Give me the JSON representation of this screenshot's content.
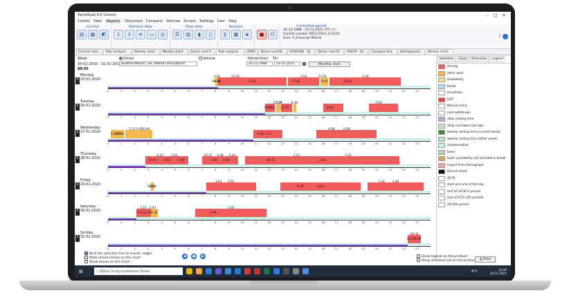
{
  "window": {
    "title": "TachoScan 6.6 Control",
    "menu": [
      "Control",
      "Data",
      "Reports",
      "Document",
      "Company",
      "Vehicles",
      "Drivers",
      "Settings",
      "User",
      "Help"
    ],
    "active_menu": "Reports"
  },
  "ribbon": {
    "groups": [
      {
        "label": "Control",
        "buttons": 3
      },
      {
        "label": "Retrieve data",
        "buttons": 5
      },
      {
        "label": "View data",
        "buttons": 4
      },
      {
        "label": "Analysis",
        "buttons": 3
      },
      {
        "label": "",
        "buttons": 2
      }
    ],
    "controlled_period": {
      "title": "Controlled period",
      "range": "26-12-1988 - 23-11-2021 UTC+1",
      "control_number": "Control number 0012-2021-123123",
      "user": "User: A_Franczyk Michał"
    }
  },
  "tabs": [
    "Current cont...",
    "Risk analysis ...",
    "Weekly chart...",
    "Weekly chart...",
    "Driver card P...",
    "Risk analysis ...",
    "DSRC",
    "Driver card M...",
    "GTKR188 - Di...",
    "Driver card M...",
    "P407R - Dr...",
    "Compare driv...",
    "Infringement...",
    "Weekly chart..."
  ],
  "header": {
    "week_label": "Week",
    "week_value": "25-01-2010 - 31-01-2010",
    "total": "88:05",
    "driver_label": "Driver",
    "vehicle_label": "Vehicle",
    "driver_value": "Budfeld Marion, GR 18WXBT3SFSQ6ER0",
    "period_from_label": "Period from",
    "till_label": "Till",
    "from_value": "26-12-1988",
    "till_value": "23-11-2021",
    "monthly_button": "Monthly chart"
  },
  "ticks": [
    "0",
    "1",
    "2",
    "3",
    "4",
    "5",
    "6",
    "7",
    "8",
    "9",
    "10",
    "11",
    "12",
    "13",
    "14",
    "15",
    "16",
    "17",
    "18",
    "19",
    "20",
    "21",
    "22",
    "23"
  ],
  "days": [
    {
      "name": "Monday",
      "date": "25-01-2010",
      "marks": [
        "06:28",
        "15:20",
        "17:30",
        "23:59",
        "12:44",
        "3:24",
        "0:54",
        "1:04",
        "0:45",
        "1:04",
        "0:44"
      ],
      "red": [
        [
          8.2,
          13.3
        ],
        [
          13.4,
          15.7
        ],
        [
          16.5,
          21.8
        ]
      ],
      "orange": [
        [
          8.0,
          8.2
        ],
        [
          15.8,
          16.4
        ]
      ]
    },
    {
      "name": "Tuesday",
      "date": "26-01-2010",
      "marks": [
        "06:28",
        "12:43",
        "22:47",
        "8:38",
        "2:04",
        "0:09",
        "2:11",
        "2:19"
      ],
      "red": [
        [
          11.7,
          12.4
        ],
        [
          12.9,
          13.7
        ],
        [
          16.0,
          17.5
        ],
        [
          19.4,
          21.6
        ]
      ],
      "orange": [
        [
          12.5,
          12.8
        ],
        [
          13.8,
          14.0
        ]
      ]
    },
    {
      "name": "Wednesday",
      "date": "27-01-2010",
      "marks": [
        "2:23",
        "2:23",
        "4:45",
        "0:58",
        "1:22",
        "1:45",
        "1:13",
        "0:58",
        "0:48",
        "10:49"
      ],
      "red": [
        [
          10.8,
          13.0
        ],
        [
          15.5,
          20.0
        ]
      ],
      "orange": [
        [
          0.2,
          1.2
        ],
        [
          1.3,
          3.3
        ]
      ]
    },
    {
      "name": "Thursday",
      "date": "28-01-2010",
      "marks": [
        "03:32",
        "03:47",
        "06:31",
        "0:43",
        "1:00",
        "2:23",
        "0:43",
        "0:48",
        "2:34",
        "1:03",
        "2:04",
        "1:05",
        "1:04",
        "0:44"
      ],
      "red": [
        [
          2.8,
          6.0
        ],
        [
          7.0,
          9.7
        ],
        [
          10.2,
          21.7
        ]
      ],
      "orange": []
    },
    {
      "name": "Friday",
      "date": "29-01-2010",
      "marks": [
        "03:32",
        "3:03",
        "5:36",
        "1:16",
        "1:00",
        "1:02",
        "2:03",
        "1:48",
        "2:11"
      ],
      "red": [
        [
          7.3,
          11.0
        ],
        [
          12.8,
          18.8
        ],
        [
          19.3,
          23.5
        ]
      ],
      "orange": [
        [
          3.2,
          3.4
        ]
      ]
    },
    {
      "name": "Saturday",
      "date": "30-01-2010",
      "marks": [
        "3:11",
        "0:47",
        "2:06",
        "2:07",
        "0:36",
        "1:00",
        "11:02"
      ],
      "red": [
        [
          2.1,
          3.2
        ],
        [
          6.5,
          11.8
        ]
      ],
      "orange": [
        [
          3.2,
          3.7
        ]
      ]
    },
    {
      "name": "Sunday",
      "date": "31-01-2010",
      "marks": [
        "22:18",
        "08:36",
        "3:00"
      ],
      "red": [
        [
          22.3,
          23.3
        ]
      ],
      "orange": []
    }
  ],
  "legend": {
    "tabs": [
      "Selection",
      "Days",
      "Overview",
      "Legend"
    ],
    "active_tab": "Legend",
    "items": [
      {
        "label": "driving",
        "color": "#f25b5b"
      },
      {
        "label": "other work",
        "color": "#f7b84a"
      },
      {
        "label": "availability",
        "color": "#f7e08a"
      },
      {
        "label": "break",
        "color": "#aee6f0"
      },
      {
        "label": "ferry/train",
        "color": "#ffffff"
      },
      {
        "label": "OUT",
        "color": "#ff4040"
      },
      {
        "label": "Manual entry",
        "color": "#ffffff"
      },
      {
        "label": "card withdrawn",
        "color": "#ffffff"
      },
      {
        "label": "daily resting time",
        "color": "#c89be8"
      },
      {
        "label": "daily rest taken too late",
        "color": "#d9d9d9"
      },
      {
        "label": "weekly resting time (current week)",
        "color": "#3a8f3a"
      },
      {
        "label": "weekly resting time (other week)",
        "color": "#b8e6b8"
      },
      {
        "label": "compensation",
        "color": "#c7f0f0"
      },
      {
        "label": "team",
        "color": "#b0d0b0"
      },
      {
        "label": "team availability not included in break",
        "color": "#e0a050"
      },
      {
        "label": "import from tachograph",
        "color": "#f0a0a0"
      },
      {
        "label": "Record sheet",
        "color": "#111111"
      },
      {
        "label": "AETR",
        "color": "#ffffff"
      },
      {
        "label": "start and end of the day",
        "color": "#ffffff"
      },
      {
        "label": "end of 24/30-h period",
        "color": "#ffffff"
      },
      {
        "label": "end of 6/12 24h periods",
        "color": "#ffffff"
      },
      {
        "label": "24/30h period",
        "color": "#ffffff"
      }
    ]
  },
  "bottom": {
    "bind_selection": "Bind the selection line to events' edges",
    "mark_sheets": "Mark record sheets on the chart",
    "show_leaves": "Show leaves on the chart",
    "show_legend_print": "Show legend on the printout",
    "show_activities_print": "Show activities list on the printout",
    "print_button": "Print"
  },
  "taskbar": {
    "search_placeholder": "Wpisz tu wyszukiwane słowa",
    "weather": "4°C",
    "time": "12:45",
    "date": "24.11.2021"
  }
}
